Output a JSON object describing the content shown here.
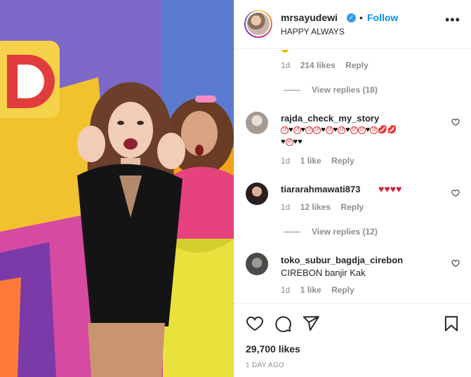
{
  "header": {
    "username": "mrsayudewi",
    "separator": "•",
    "follow_label": "Follow",
    "subtitle": "HAPPY ALWAYS",
    "more_label": "•••"
  },
  "comments": [
    {
      "time": "1d",
      "likes": "214 likes",
      "reply_label": "Reply",
      "view_replies": "View replies (18)"
    },
    {
      "username": "rajda_check_my_story",
      "time": "1d",
      "likes": "1 like",
      "reply_label": "Reply"
    },
    {
      "username": "tiararahmawati873",
      "time": "1d",
      "likes": "12 likes",
      "reply_label": "Reply",
      "view_replies": "View replies (12)"
    },
    {
      "username": "toko_subur_bagdja_cirebon",
      "text": "CIREBON banjir Kak",
      "time": "1d",
      "likes": "1 like",
      "reply_label": "Reply"
    }
  ],
  "footer": {
    "likes_total": "29,700 likes",
    "posted": "1 DAY AGO"
  },
  "icons": {
    "like": "heart-outline-icon",
    "comment": "comment-bubble-icon",
    "share": "paper-plane-icon",
    "save": "bookmark-icon",
    "verified": "verified-badge-icon"
  },
  "colors": {
    "follow": "#0095f6",
    "verified": "#3897f0",
    "muted": "#8e8e8e",
    "text": "#262626"
  }
}
